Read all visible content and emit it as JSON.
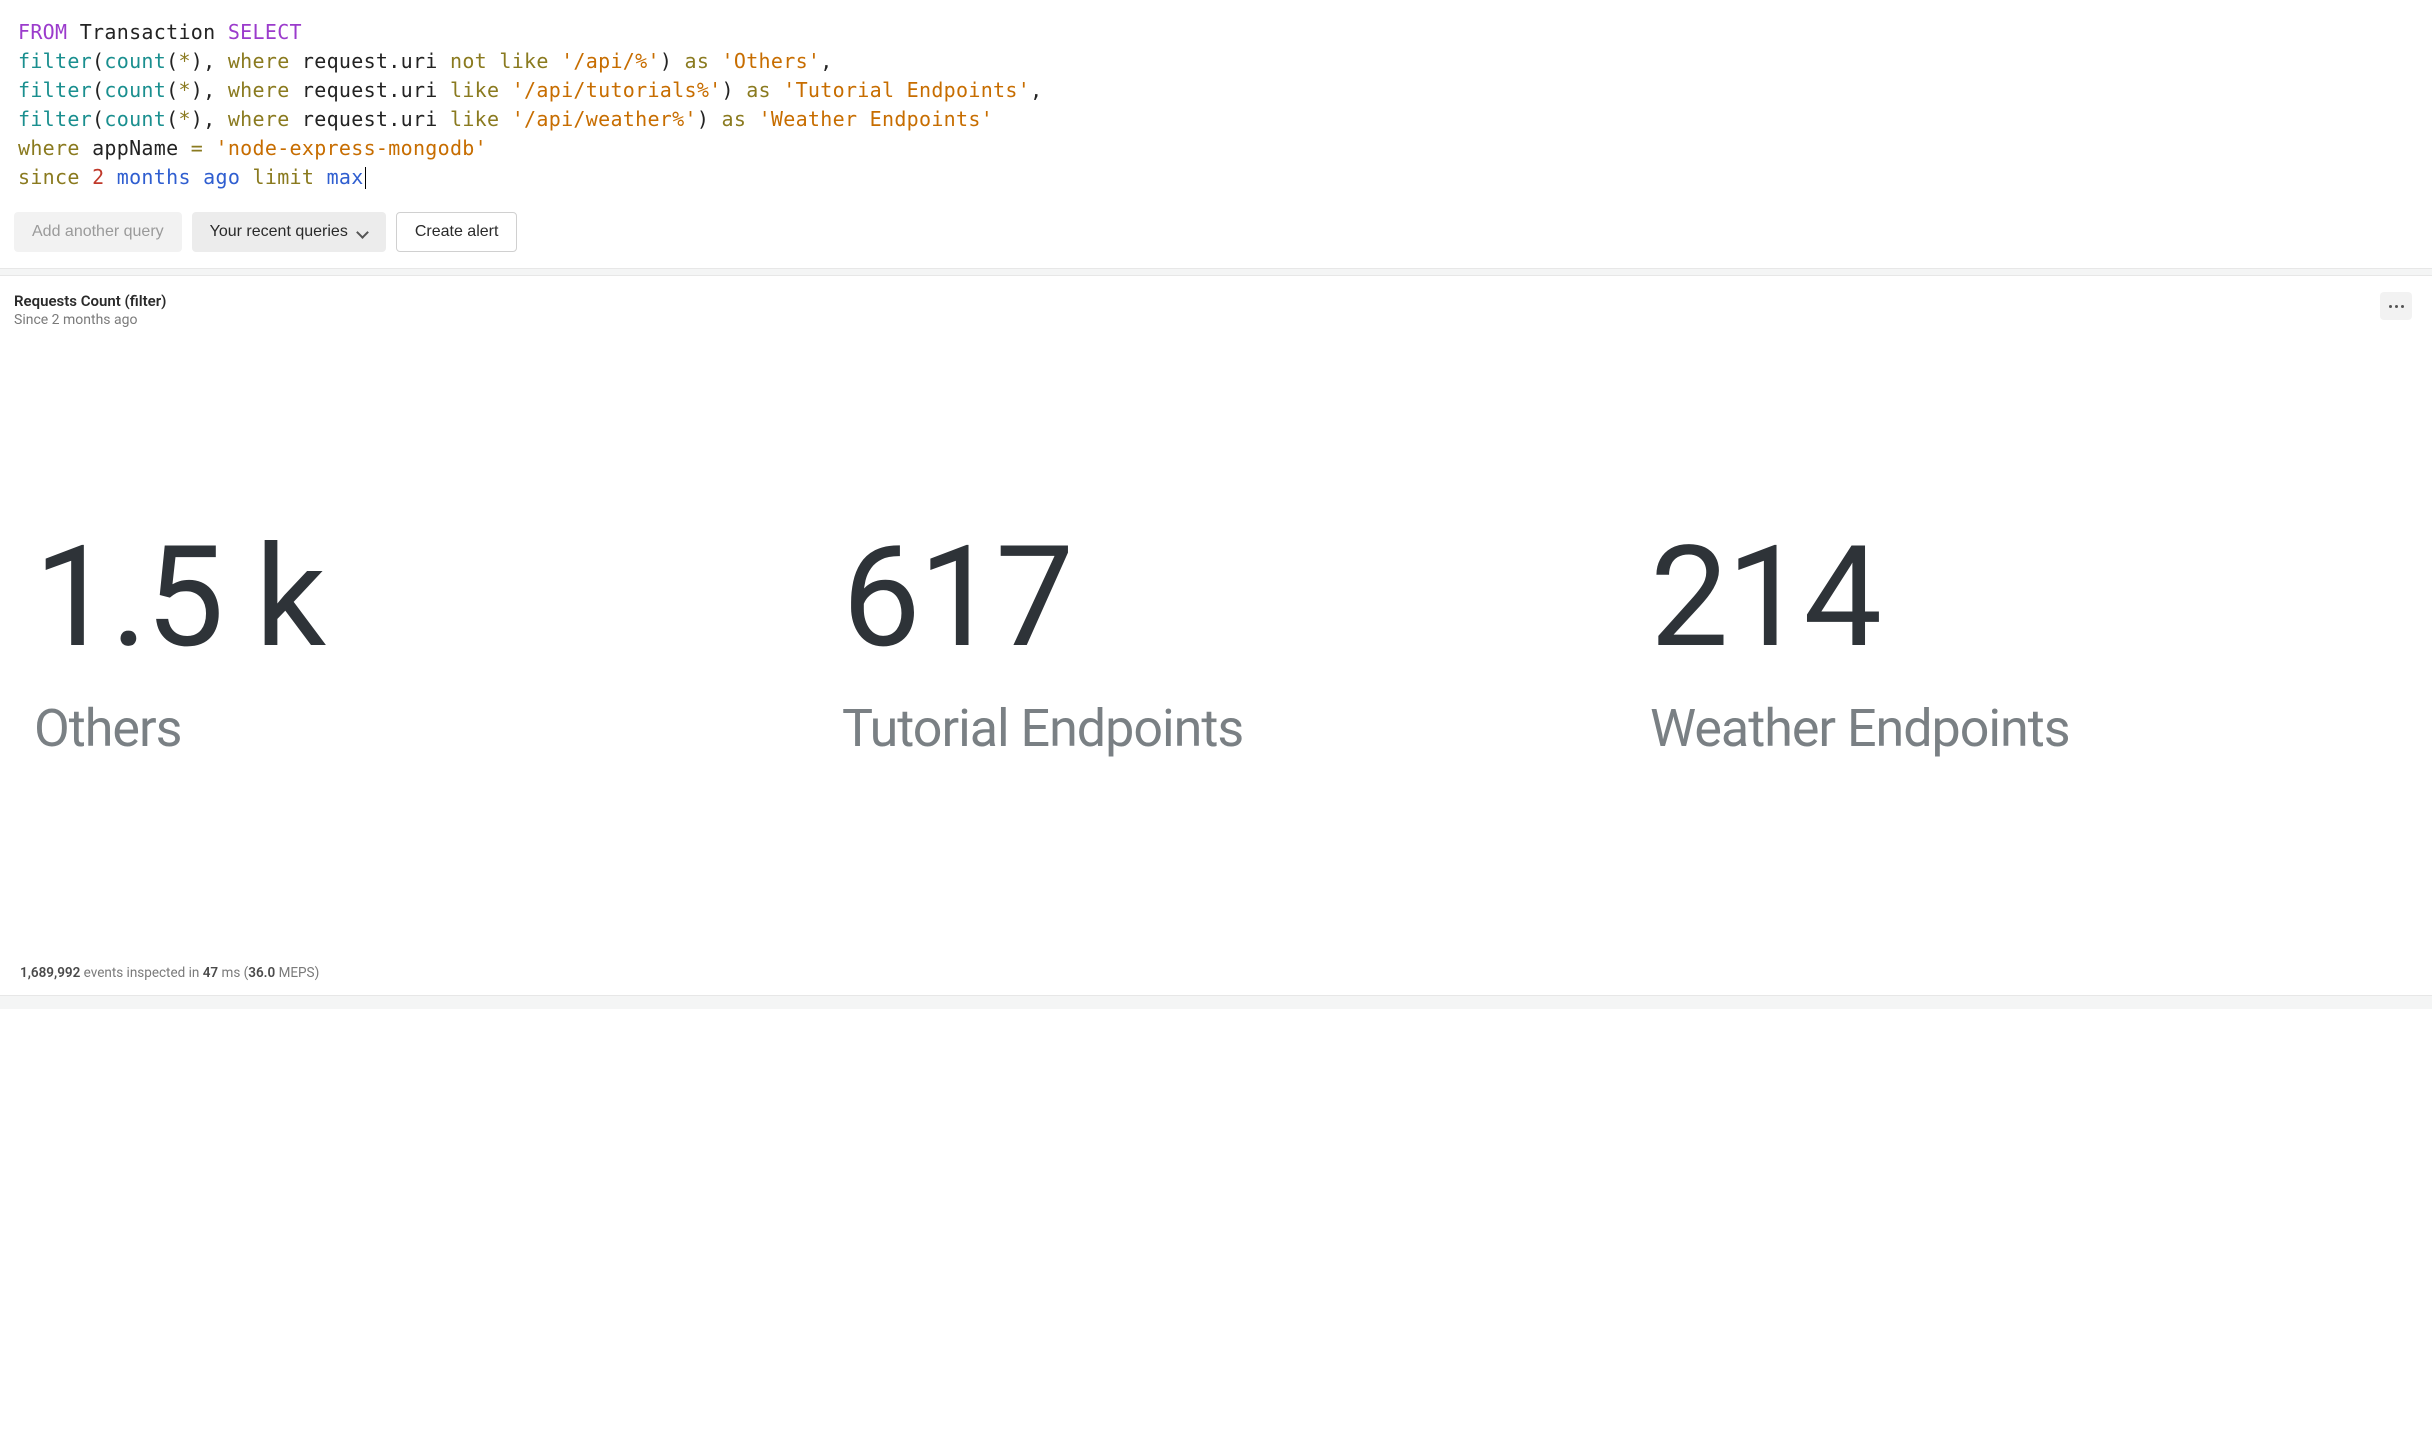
{
  "query": {
    "tokens": {
      "from": "FROM",
      "transaction": "Transaction",
      "select": "SELECT",
      "filter": "filter",
      "count": "count",
      "star": "*",
      "where": "where",
      "request_uri": "request.uri",
      "not_like": "not like",
      "like": "like",
      "as": "as",
      "app_name": "appName",
      "eq": "=",
      "since": "since",
      "limit": "limit",
      "num2": "2",
      "months_ago": "months ago",
      "max": "max",
      "str_api": "'/api/%'",
      "str_others": "'Others'",
      "str_tutorials": "'/api/tutorials%'",
      "str_tutorial_ep": "'Tutorial Endpoints'",
      "str_weather": "'/api/weather%'",
      "str_weather_ep": "'Weather Endpoints'",
      "str_appname_val": "'node-express-mongodb'",
      "comma": ",",
      "lparen": "(",
      "rparen": ")"
    }
  },
  "actions": {
    "add_another_query": "Add another query",
    "recent_queries": "Your recent queries",
    "create_alert": "Create alert"
  },
  "result": {
    "title": "Requests Count (filter)",
    "subtitle": "Since 2 months ago",
    "metrics": [
      {
        "value": "1.5 k",
        "label": "Others"
      },
      {
        "value": "617",
        "label": "Tutorial Endpoints"
      },
      {
        "value": "214",
        "label": "Weather Endpoints"
      }
    ]
  },
  "status": {
    "events": "1,689,992",
    "text_events": " events inspected in ",
    "ms": "47",
    "text_ms": " ms (",
    "meps": "36.0",
    "text_meps": " MEPS)"
  }
}
